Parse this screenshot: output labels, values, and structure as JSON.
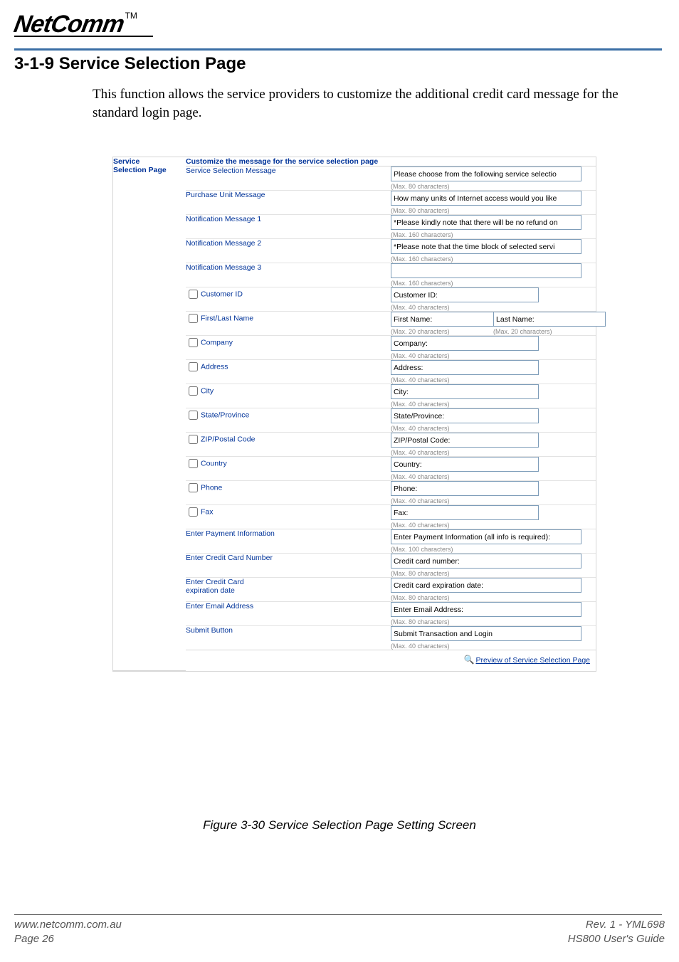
{
  "logo": {
    "brand": "NetComm",
    "tm": "TM"
  },
  "heading": "3-1-9  Service Selection Page",
  "body_text": "This function allows the service providers to customize the additional credit card message for the standard login page.",
  "panel": {
    "side_label_line1": "Service",
    "side_label_line2": "Selection Page",
    "title": "Customize the message for the service selection page",
    "rows": {
      "service_selection_message": {
        "label": "Service Selection Message",
        "value": "Please choose from the following service selectio",
        "hint": "(Max. 80 characters)"
      },
      "purchase_unit_message": {
        "label": "Purchase Unit Message",
        "value": "How many units of Internet access would you like",
        "hint": "(Max. 80 characters)"
      },
      "notification_message_1": {
        "label": "Notification Message 1",
        "value": "*Please kindly note that there will be no refund on",
        "hint": "(Max. 160 characters)"
      },
      "notification_message_2": {
        "label": "Notification Message 2",
        "value": "*Please note that the time block of selected servi",
        "hint": "(Max. 160 characters)"
      },
      "notification_message_3": {
        "label": "Notification Message 3",
        "value": "",
        "hint": "(Max. 160 characters)"
      },
      "customer_id": {
        "label": "Customer ID",
        "value": "Customer ID:",
        "hint": "(Max. 40 characters)"
      },
      "first_last_name": {
        "label": "First/Last Name",
        "first_value": "First Name:",
        "first_hint": "(Max. 20 characters)",
        "last_value": "Last Name:",
        "last_hint": "(Max. 20 characters)"
      },
      "company": {
        "label": "Company",
        "value": "Company:",
        "hint": "(Max. 40 characters)"
      },
      "address": {
        "label": "Address",
        "value": "Address:",
        "hint": "(Max. 40 characters)"
      },
      "city": {
        "label": "City",
        "value": "City:",
        "hint": "(Max. 40 characters)"
      },
      "state_province": {
        "label": "State/Province",
        "value": "State/Province:",
        "hint": "(Max. 40 characters)"
      },
      "zip_postal": {
        "label": "ZIP/Postal Code",
        "value": "ZIP/Postal Code:",
        "hint": "(Max. 40 characters)"
      },
      "country": {
        "label": "Country",
        "value": "Country:",
        "hint": "(Max. 40 characters)"
      },
      "phone": {
        "label": "Phone",
        "value": "Phone:",
        "hint": "(Max. 40 characters)"
      },
      "fax": {
        "label": "Fax",
        "value": "Fax:",
        "hint": "(Max. 40 characters)"
      },
      "enter_payment_info": {
        "label": "Enter Payment Information",
        "value": "Enter Payment Information (all info is required):",
        "hint": "(Max. 100 characters)"
      },
      "enter_cc_number": {
        "label": "Enter Credit Card Number",
        "value": "Credit card number:",
        "hint": "(Max. 80 characters)"
      },
      "enter_cc_exp": {
        "label_line1": "Enter Credit Card",
        "label_line2": "expiration date",
        "value": "Credit card expiration date:",
        "hint": "(Max. 80 characters)"
      },
      "enter_email": {
        "label": "Enter Email Address",
        "value": "Enter Email Address:",
        "hint": "(Max. 80 characters)"
      },
      "submit_button": {
        "label": "Submit Button",
        "value": "Submit Transaction and Login",
        "hint": "(Max. 40 characters)"
      }
    },
    "preview_link": "Preview of Service Selection Page"
  },
  "figure_caption": "Figure 3-30 Service Selection Page Setting Screen",
  "footer": {
    "left_line1": "www.netcomm.com.au",
    "left_line2": "Page 26",
    "right_line1": "Rev. 1 - YML698",
    "right_line2": "HS800 User's Guide"
  }
}
